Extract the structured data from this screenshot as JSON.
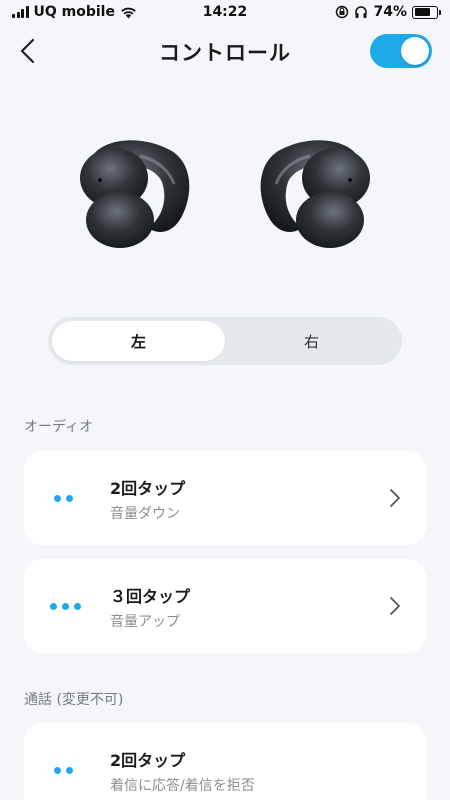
{
  "status_bar": {
    "carrier": "UQ mobile",
    "time": "14:22",
    "battery_percent": "74%",
    "battery_level": 0.74
  },
  "header": {
    "title": "コントロール",
    "toggle_on": true
  },
  "segments": {
    "left": "左",
    "right": "右",
    "selected": "左"
  },
  "sections": {
    "audio": "オーディオ",
    "call": "通話 (変更不可)"
  },
  "cards": [
    {
      "title": "2回タップ",
      "subtitle": "音量ダウン",
      "dots": 2
    },
    {
      "title": "３回タップ",
      "subtitle": "音量アップ",
      "dots": 3
    },
    {
      "title": "2回タップ",
      "subtitle": "着信に応答/着信を拒否",
      "dots": 2
    }
  ],
  "colors": {
    "accent": "#1ea9e8",
    "background": "#f4f6f9",
    "card": "#ffffff"
  },
  "icons": {
    "back": "chevron-left-icon",
    "chevron": "chevron-right-icon",
    "wifi": "wifi-icon",
    "signal": "signal-icon",
    "headphones": "headphones-icon",
    "lock_rotation": "rotation-lock-icon",
    "battery": "battery-icon"
  }
}
